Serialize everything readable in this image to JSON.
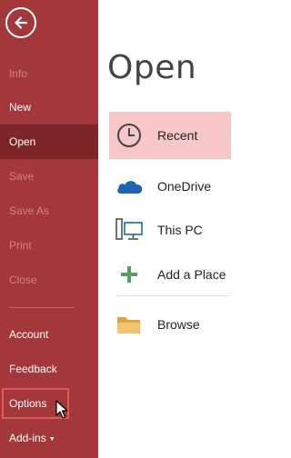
{
  "backstage": {
    "nav_items": [
      {
        "label": "Info",
        "state": "disabled"
      },
      {
        "label": "New",
        "state": "enabled"
      },
      {
        "label": "Open",
        "state": "selected"
      },
      {
        "label": "Save",
        "state": "disabled"
      },
      {
        "label": "Save As",
        "state": "disabled"
      },
      {
        "label": "Print",
        "state": "disabled"
      },
      {
        "label": "Close",
        "state": "disabled"
      },
      {
        "label": "Account",
        "state": "enabled"
      },
      {
        "label": "Feedback",
        "state": "enabled"
      },
      {
        "label": "Options",
        "state": "highlighted"
      },
      {
        "label": "Add-ins",
        "state": "enabled"
      }
    ],
    "colors": {
      "sidebar": "#a4373a",
      "sidebar_selected": "#7e2528",
      "sidebar_disabled_text": "#cf8185",
      "highlight_outline": "#e05a5a",
      "location_selected": "#f7c7c8"
    }
  },
  "main": {
    "title": "Open",
    "locations": [
      {
        "label": "Recent",
        "icon": "clock-icon",
        "selected": true
      },
      {
        "label": "OneDrive",
        "icon": "cloud-icon",
        "selected": false
      },
      {
        "label": "This PC",
        "icon": "computer-icon",
        "selected": false
      },
      {
        "label": "Add a Place",
        "icon": "plus-icon",
        "selected": false
      },
      {
        "label": "Browse",
        "icon": "folder-icon",
        "selected": false
      }
    ]
  }
}
